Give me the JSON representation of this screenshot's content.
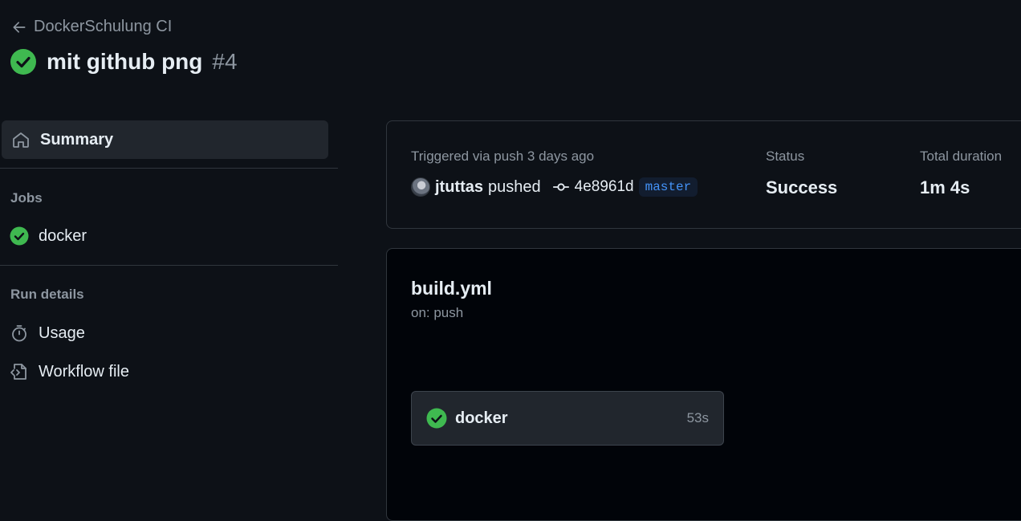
{
  "header": {
    "back_label": "DockerSchulung CI",
    "run_title": "mit github png",
    "run_number": "#4"
  },
  "sidebar": {
    "summary_label": "Summary",
    "jobs_heading": "Jobs",
    "jobs": [
      {
        "label": "docker",
        "status": "success"
      }
    ],
    "run_details_heading": "Run details",
    "details": [
      {
        "label": "Usage",
        "icon": "stopwatch-icon"
      },
      {
        "label": "Workflow file",
        "icon": "file-code-icon"
      }
    ]
  },
  "summary": {
    "trigger_text": "Triggered via push 3 days ago",
    "user": "jtuttas",
    "action": "pushed",
    "commit_sha": "4e8961d",
    "branch": "master",
    "status_label": "Status",
    "status_value": "Success",
    "duration_label": "Total duration",
    "duration_value": "1m 4s"
  },
  "workflow": {
    "file_name": "build.yml",
    "trigger": "on: push",
    "jobs": [
      {
        "name": "docker",
        "duration": "53s",
        "status": "success"
      }
    ]
  },
  "colors": {
    "background": "#0d1117",
    "success": "#3fb950",
    "accent_link": "#4493f8",
    "muted_text": "#8d96a0"
  }
}
